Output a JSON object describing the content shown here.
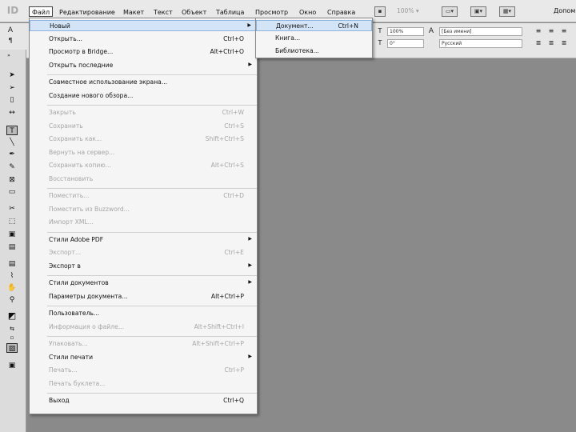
{
  "app": {
    "logo": "ID"
  },
  "menubar": {
    "items": [
      "Файл",
      "Редактирование",
      "Макет",
      "Текст",
      "Объект",
      "Таблица",
      "Просмотр",
      "Окно",
      "Справка"
    ],
    "zoom": "100%",
    "right_label": "Допом"
  },
  "control": {
    "size": "100%",
    "angle": "0°",
    "style": "[Без имени]",
    "language": "Русский"
  },
  "file_menu": {
    "items": [
      {
        "label": "Новый",
        "shortcut": "",
        "submenu": true,
        "disabled": false,
        "highlight": true
      },
      {
        "label": "Открыть...",
        "shortcut": "Ctrl+O",
        "submenu": false,
        "disabled": false
      },
      {
        "label": "Просмотр в Bridge...",
        "shortcut": "Alt+Ctrl+O",
        "submenu": false,
        "disabled": false
      },
      {
        "label": "Открыть последние",
        "shortcut": "",
        "submenu": true,
        "disabled": false
      },
      {
        "sep": true
      },
      {
        "label": "Совместное использование экрана...",
        "shortcut": "",
        "submenu": false,
        "disabled": false
      },
      {
        "label": "Создание нового обзора...",
        "shortcut": "",
        "submenu": false,
        "disabled": false
      },
      {
        "sep": true
      },
      {
        "label": "Закрыть",
        "shortcut": "Ctrl+W",
        "submenu": false,
        "disabled": true
      },
      {
        "label": "Сохранить",
        "shortcut": "Ctrl+S",
        "submenu": false,
        "disabled": true
      },
      {
        "label": "Сохранить как...",
        "shortcut": "Shift+Ctrl+S",
        "submenu": false,
        "disabled": true
      },
      {
        "label": "Вернуть на сервер...",
        "shortcut": "",
        "submenu": false,
        "disabled": true
      },
      {
        "label": "Сохранить копию...",
        "shortcut": "Alt+Ctrl+S",
        "submenu": false,
        "disabled": true
      },
      {
        "label": "Восстановить",
        "shortcut": "",
        "submenu": false,
        "disabled": true
      },
      {
        "sep": true
      },
      {
        "label": "Поместить...",
        "shortcut": "Ctrl+D",
        "submenu": false,
        "disabled": true
      },
      {
        "label": "Поместить из Buzzword...",
        "shortcut": "",
        "submenu": false,
        "disabled": true
      },
      {
        "label": "Импорт XML...",
        "shortcut": "",
        "submenu": false,
        "disabled": true
      },
      {
        "sep": true
      },
      {
        "label": "Стили Adobe PDF",
        "shortcut": "",
        "submenu": true,
        "disabled": false
      },
      {
        "label": "Экспорт...",
        "shortcut": "Ctrl+E",
        "submenu": false,
        "disabled": true
      },
      {
        "label": "Экспорт в",
        "shortcut": "",
        "submenu": true,
        "disabled": false
      },
      {
        "sep": true
      },
      {
        "label": "Стили документов",
        "shortcut": "",
        "submenu": true,
        "disabled": false
      },
      {
        "label": "Параметры документа...",
        "shortcut": "Alt+Ctrl+P",
        "submenu": false,
        "disabled": false
      },
      {
        "sep": true
      },
      {
        "label": "Пользователь...",
        "shortcut": "",
        "submenu": false,
        "disabled": false
      },
      {
        "label": "Информация о файле...",
        "shortcut": "Alt+Shift+Ctrl+I",
        "submenu": false,
        "disabled": true
      },
      {
        "sep": true
      },
      {
        "label": "Упаковать...",
        "shortcut": "Alt+Shift+Ctrl+P",
        "submenu": false,
        "disabled": true
      },
      {
        "label": "Стили печати",
        "shortcut": "",
        "submenu": true,
        "disabled": false
      },
      {
        "label": "Печать...",
        "shortcut": "Ctrl+P",
        "submenu": false,
        "disabled": true
      },
      {
        "label": "Печать буклета...",
        "shortcut": "",
        "submenu": false,
        "disabled": true
      },
      {
        "sep": true
      },
      {
        "label": "Выход",
        "shortcut": "Ctrl+Q",
        "submenu": false,
        "disabled": false
      }
    ]
  },
  "new_submenu": {
    "items": [
      {
        "label": "Документ...",
        "shortcut": "Ctrl+N"
      },
      {
        "label": "Книга...",
        "shortcut": ""
      },
      {
        "label": "Библиотека...",
        "shortcut": ""
      }
    ]
  },
  "tools": [
    "selection-arrow-icon",
    "direct-select-icon",
    "page-tool-icon",
    "gap-tool-icon",
    "type-tool-icon",
    "line-tool-icon",
    "pen-tool-icon",
    "pencil-tool-icon",
    "rectangle-frame-icon",
    "rectangle-icon",
    "scissors-icon",
    "free-transform-icon",
    "gradient-swatch-icon",
    "gradient-feather-icon",
    "note-icon",
    "eyedropper-icon",
    "hand-icon",
    "zoom-icon",
    "fill-stroke-icon",
    "swap-icon",
    "default-colors-icon",
    "apply-color-icon",
    "view-mode-icon"
  ]
}
